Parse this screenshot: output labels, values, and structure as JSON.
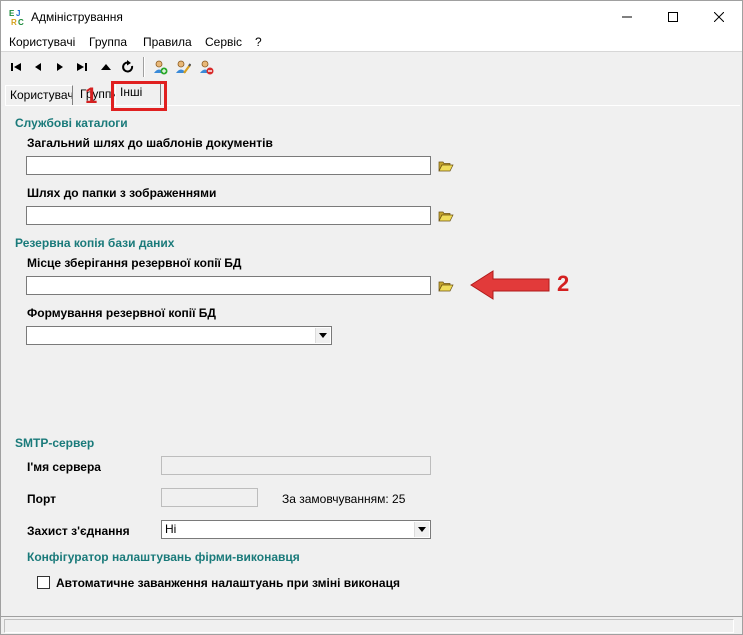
{
  "window": {
    "title": "Адміністрування"
  },
  "menu": {
    "items": [
      "Користувачі",
      "Группа",
      "Правила",
      "Сервіс",
      "?"
    ]
  },
  "tabs": [
    {
      "label": "Користувачі"
    },
    {
      "label": "Группи"
    },
    {
      "label": "Інші"
    }
  ],
  "annotations": {
    "one": "1",
    "two": "2"
  },
  "catalogs": {
    "title": "Службові каталоги",
    "templates_label": "Загальний шлях до шаблонів документів",
    "templates_value": "",
    "images_label": "Шлях до папки з зображеннями",
    "images_value": ""
  },
  "backup": {
    "title": "Резервна копія бази даних",
    "location_label": "Місце зберігання резервної копії БД",
    "location_value": "",
    "mode_label": "Формування резервної копії БД",
    "mode_value": ""
  },
  "smtp": {
    "title": "SMTP-сервер",
    "server_label": "І'мя сервера",
    "server_value": "",
    "port_label": "Порт",
    "port_value": "",
    "default_note": "За замовчуванням: 25",
    "security_label": "Захист з'єднання",
    "security_value": "Ні"
  },
  "configurator": {
    "title": "Конфігуратор налаштувань фірми-виконавця",
    "auto_label": "Автоматичне заванження налаштуань при зміні виконаця",
    "auto_checked": false
  },
  "colors": {
    "section": "#1a7a7a",
    "annotation": "#d42020",
    "folder": "#e8d24a"
  },
  "icons": {
    "toolbar": [
      "first-icon",
      "prev-icon",
      "next-icon",
      "last-icon",
      "up-icon",
      "refresh-icon",
      "add-user-icon",
      "edit-user-icon",
      "delete-user-icon"
    ],
    "field": "folder-open-icon"
  }
}
